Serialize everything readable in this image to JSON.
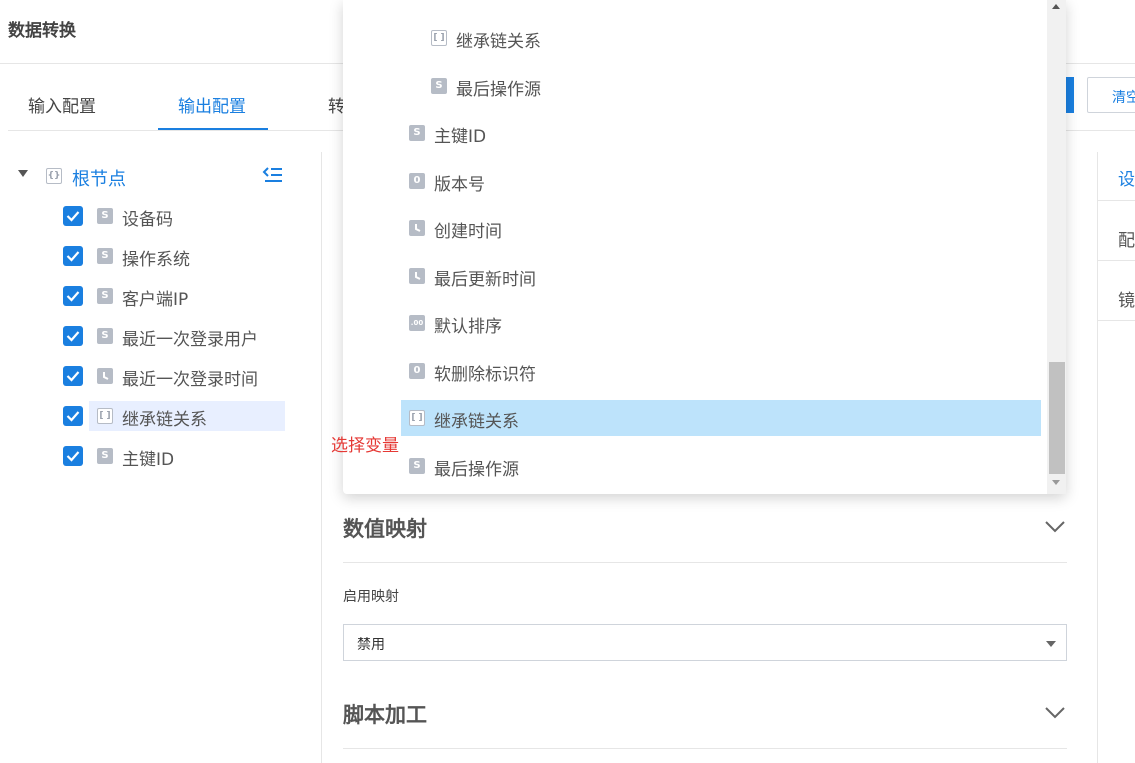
{
  "app": {
    "title": "数据转换"
  },
  "tabs": [
    {
      "label": "输入配置",
      "active": false
    },
    {
      "label": "输出配置",
      "active": true
    },
    {
      "label": "转",
      "active": false
    }
  ],
  "tree": {
    "root_label": "根节点",
    "root_icon": "object-icon",
    "items": [
      {
        "label": "设备码",
        "type": "S",
        "checked": true,
        "selected": false
      },
      {
        "label": "操作系统",
        "type": "S",
        "checked": true,
        "selected": false
      },
      {
        "label": "客户端IP",
        "type": "S",
        "checked": true,
        "selected": false
      },
      {
        "label": "最近一次登录用户",
        "type": "S",
        "checked": true,
        "selected": false
      },
      {
        "label": "最近一次登录时间",
        "type": "clock",
        "checked": true,
        "selected": false
      },
      {
        "label": "继承链关系",
        "type": "array",
        "checked": true,
        "selected": true
      },
      {
        "label": "主键ID",
        "type": "S",
        "checked": true,
        "selected": false
      }
    ]
  },
  "dropdown": {
    "items": [
      {
        "label": "继承链关系",
        "type": "array",
        "indent": 1,
        "highlighted": false
      },
      {
        "label": "最后操作源",
        "type": "S",
        "indent": 1,
        "highlighted": false
      },
      {
        "label": "主键ID",
        "type": "S",
        "indent": 0,
        "highlighted": false
      },
      {
        "label": "版本号",
        "type": "0",
        "indent": 0,
        "highlighted": false
      },
      {
        "label": "创建时间",
        "type": "clock",
        "indent": 0,
        "highlighted": false
      },
      {
        "label": "最后更新时间",
        "type": "clock",
        "indent": 0,
        "highlighted": false
      },
      {
        "label": "默认排序",
        "type": ".00",
        "indent": 0,
        "highlighted": false
      },
      {
        "label": "软删除标识符",
        "type": "0",
        "indent": 0,
        "highlighted": false
      },
      {
        "label": "继承链关系",
        "type": "array",
        "indent": 0,
        "highlighted": true
      },
      {
        "label": "最后操作源",
        "type": "S",
        "indent": 0,
        "highlighted": false
      }
    ]
  },
  "annotation": "选择变量",
  "sections": {
    "value_mapping": {
      "title": "数值映射",
      "enable_label": "启用映射",
      "select_value": "禁用"
    },
    "script_processing": {
      "title": "脚本加工"
    }
  },
  "right_panel": {
    "clear_button": "清空",
    "tab_label": "设",
    "row1": "配",
    "row2": "镜"
  },
  "colors": {
    "accent": "#1a7fe0",
    "highlight": "#bde3fb",
    "annotation": "#e53935",
    "icon_gray": "#b6bcc6"
  }
}
